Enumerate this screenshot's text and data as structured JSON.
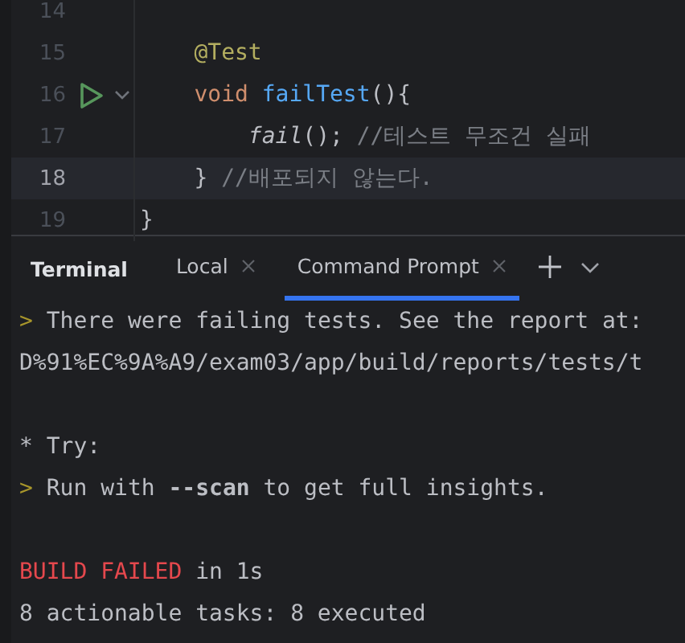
{
  "editor": {
    "lines": [
      {
        "number": "14",
        "selected": false,
        "runnable": false,
        "foldable": false
      },
      {
        "number": "15",
        "selected": false,
        "runnable": false,
        "foldable": false,
        "tokens": [
          {
            "kind": "annotation",
            "text": "    @Test"
          }
        ]
      },
      {
        "number": "16",
        "selected": false,
        "runnable": true,
        "foldable": true,
        "tokens": [
          {
            "kind": "keyword",
            "text": "    void "
          },
          {
            "kind": "function",
            "text": "failTest"
          },
          {
            "kind": "plain",
            "text": "(){"
          }
        ]
      },
      {
        "number": "17",
        "selected": false,
        "runnable": false,
        "foldable": false,
        "tokens": [
          {
            "kind": "call",
            "text": "        fail"
          },
          {
            "kind": "plain",
            "text": "(); "
          },
          {
            "kind": "comment",
            "text": "//테스트 무조건 실패"
          }
        ]
      },
      {
        "number": "18",
        "selected": true,
        "runnable": false,
        "foldable": false,
        "tokens": [
          {
            "kind": "plain",
            "text": "    } "
          },
          {
            "kind": "comment",
            "text": "//배포되지 않는다."
          }
        ]
      },
      {
        "number": "19",
        "selected": false,
        "runnable": false,
        "foldable": false,
        "tokens": [
          {
            "kind": "plain",
            "text": "}"
          }
        ]
      }
    ]
  },
  "terminal": {
    "title": "Terminal",
    "tabs": [
      {
        "label": "Local",
        "selected": false
      },
      {
        "label": "Command Prompt",
        "selected": true
      }
    ],
    "blocks": [
      [
        [
          {
            "kind": "prompt",
            "text": ">"
          },
          {
            "kind": "plain",
            "text": " There were failing tests. See the report at:"
          }
        ],
        [
          {
            "kind": "plain",
            "text": "D%91%EC%9A%A9/exam03/app/build/reports/tests/t"
          }
        ]
      ],
      [
        [
          {
            "kind": "plain",
            "text": "* Try:"
          }
        ],
        [
          {
            "kind": "prompt",
            "text": ">"
          },
          {
            "kind": "plain",
            "text": " Run with **--scan** to get full insights."
          }
        ]
      ],
      [
        [
          {
            "kind": "error",
            "text": "BUILD FAILED"
          },
          {
            "kind": "plain",
            "text": " in 1s"
          }
        ],
        [
          {
            "kind": "plain",
            "text": "8 actionable tasks: 8 executed"
          }
        ]
      ]
    ]
  }
}
